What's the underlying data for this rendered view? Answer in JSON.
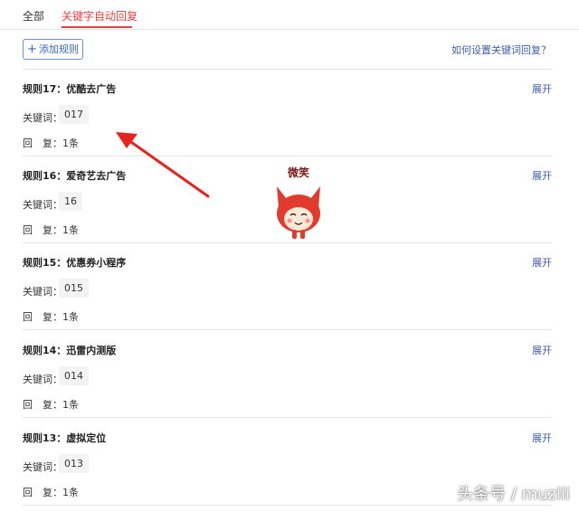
{
  "tabs": [
    {
      "label": "全部",
      "active": false
    },
    {
      "label": "关键字自动回复",
      "active": true
    }
  ],
  "toolbar": {
    "add_label": "添加规则",
    "help_link": "如何设置关键词回复？"
  },
  "rules": [
    {
      "title": "规则17：优酷去广告",
      "keyword_label": "关键词：",
      "keyword": "017",
      "reply": "回　复：1条",
      "expand": "展开"
    },
    {
      "title": "规则16：爱奇艺去广告",
      "keyword_label": "关键词：",
      "keyword": "16",
      "reply": "回　复：1条",
      "expand": "展开"
    },
    {
      "title": "规则15：优惠券小程序",
      "keyword_label": "关键词：",
      "keyword": "015",
      "reply": "回　复：1条",
      "expand": "展开"
    },
    {
      "title": "规则14：迅雷内测版",
      "keyword_label": "关键词：",
      "keyword": "014",
      "reply": "回　复：1条",
      "expand": "展开"
    },
    {
      "title": "规则13：虚拟定位",
      "keyword_label": "关键词：",
      "keyword": "013",
      "reply": "回　复：1条",
      "expand": "展开"
    }
  ],
  "annotation": {
    "sticker_caption": "微笑"
  },
  "watermark": "头条号 / muzili",
  "colors": {
    "accent": "#e64340",
    "link": "#3c5ea8",
    "button_border": "#6b8fcf",
    "arrow": "#e8221f"
  }
}
